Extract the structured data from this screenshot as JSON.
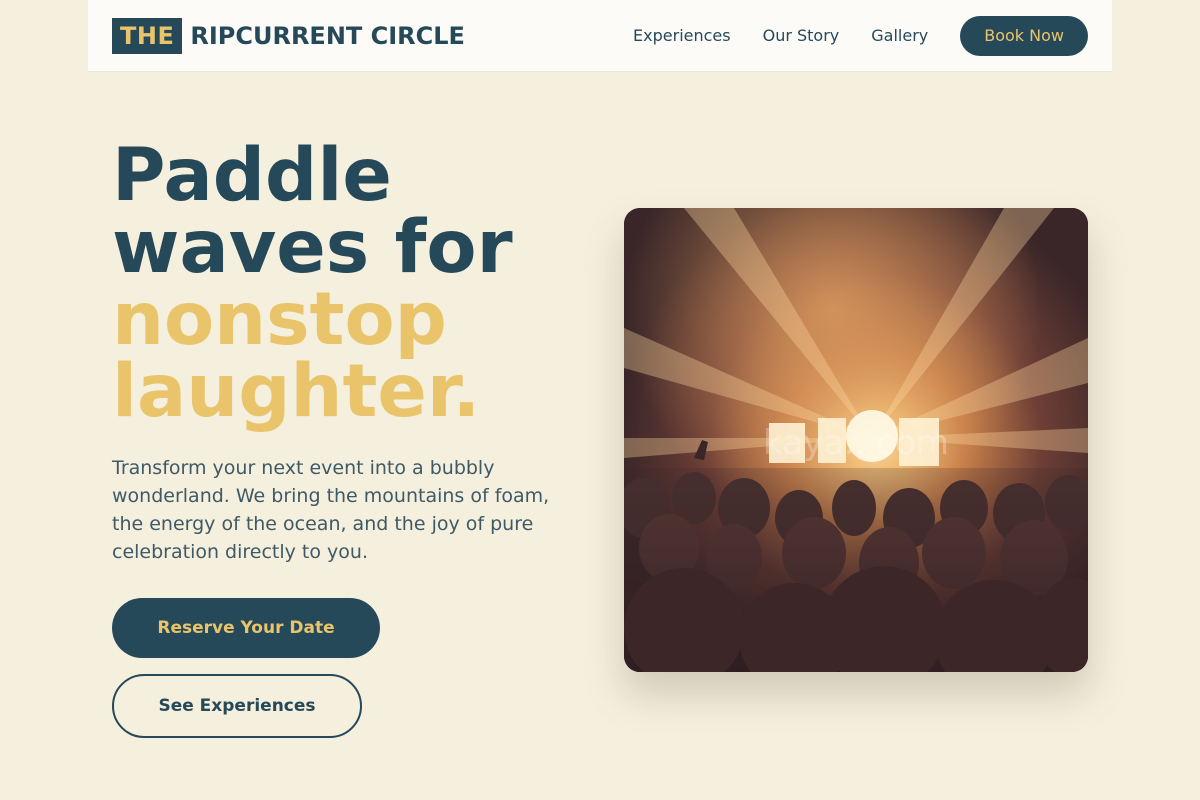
{
  "brand": {
    "box": "THE",
    "name": "RIPCURRENT CIRCLE"
  },
  "nav": {
    "items": [
      "Experiences",
      "Our Story",
      "Gallery"
    ],
    "cta": "Book Now"
  },
  "hero": {
    "title_line1": "Paddle",
    "title_line2": "waves for",
    "title_accent1": "nonstop",
    "title_accent2": "laughter.",
    "description": "Transform your next event into a bubbly wonderland. We bring the mountains of foam, the energy of the ocean, and the joy of pure celebration directly to you.",
    "primary_cta": "Reserve Your Date",
    "secondary_cta": "See Experiences"
  },
  "image": {
    "watermark": "kaya...com"
  },
  "colors": {
    "navy": "#26495a",
    "gold": "#e9c46a",
    "background": "#f5efdd"
  }
}
